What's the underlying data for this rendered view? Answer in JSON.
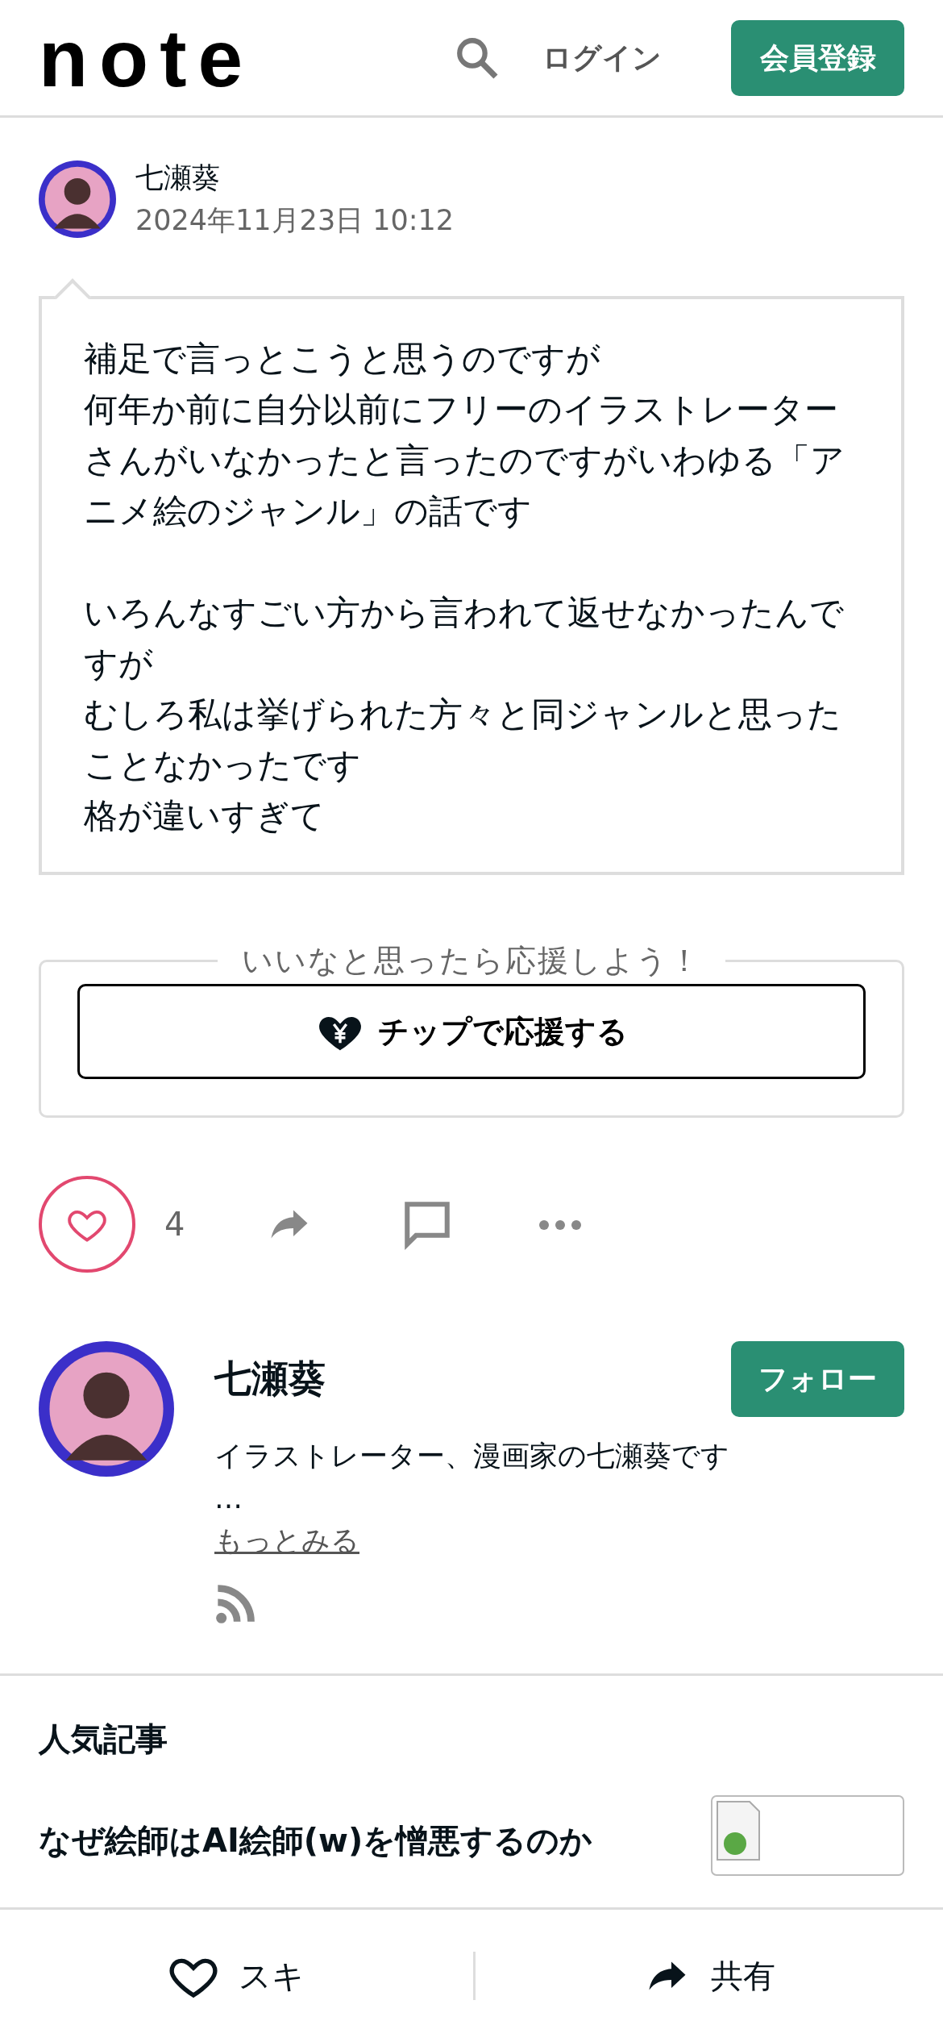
{
  "header": {
    "logo": "note",
    "login": "ログイン",
    "signup": "会員登録"
  },
  "post": {
    "author": "七瀬葵",
    "date": "2024年11月23日 10:12",
    "paragraphs": [
      [
        "補足で言っとこうと思うのですが",
        "何年か前に自分以前にフリーのイラストレーターさんがいなかったと言ったのですがいわゆる「アニメ絵のジャンル」の話です"
      ],
      [
        "いろんなすごい方から言われて返せなかったんですが",
        "むしろ私は挙げられた方々と同ジャンルと思ったことなかったです",
        "格が違いすぎて"
      ]
    ]
  },
  "tip": {
    "prompt": "いいなと思ったら応援しよう！",
    "button": "チップで応援する"
  },
  "actions": {
    "like_count": "4"
  },
  "profile": {
    "name": "七瀬葵",
    "follow": "フォロー",
    "bio": "イラストレーター、漫画家の七瀬葵です",
    "ellipsis": "…",
    "more": "もっとみる"
  },
  "popular": {
    "heading": "人気記事",
    "articles": [
      {
        "title": "なぜ絵師はAI絵師(w)を憎悪するのか"
      }
    ]
  },
  "bottom_bar": {
    "like": "スキ",
    "share": "共有"
  }
}
